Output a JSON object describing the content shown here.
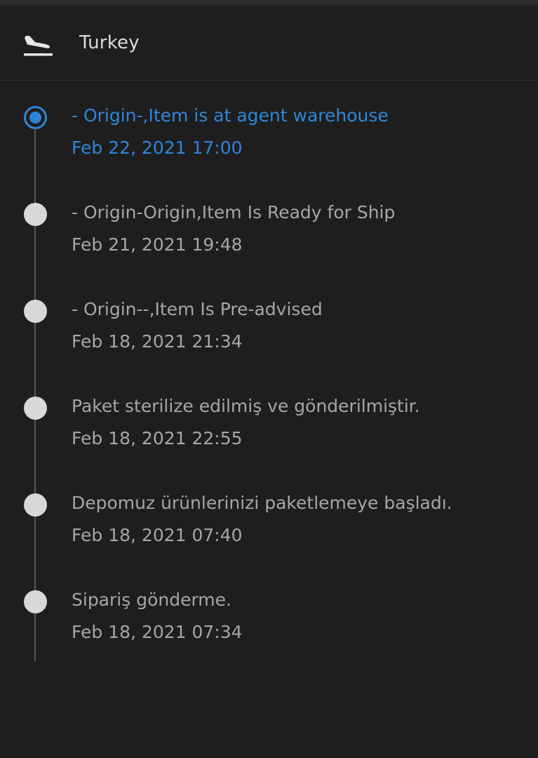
{
  "header": {
    "icon": "flight-landing-icon",
    "title": "Turkey"
  },
  "colors": {
    "background": "#1e1e1e",
    "accent": "#2f86d8",
    "muted_text": "#a6a6a6",
    "dot": "#d8d8d8"
  },
  "events": [
    {
      "description": "- Origin-,Item is at agent warehouse",
      "time": "Feb 22, 2021 17:00",
      "current": true
    },
    {
      "description": "- Origin-Origin,Item Is Ready for Ship",
      "time": "Feb 21, 2021 19:48",
      "current": false
    },
    {
      "description": "- Origin--,Item Is Pre-advised",
      "time": "Feb 18, 2021 21:34",
      "current": false
    },
    {
      "description": "Paket sterilize edilmiş ve gönderilmiştir.",
      "time": "Feb 18, 2021 22:55",
      "current": false
    },
    {
      "description": "Depomuz ürünlerinizi paketlemeye başladı.",
      "time": "Feb 18, 2021 07:40",
      "current": false
    },
    {
      "description": "Sipariş gönderme.",
      "time": "Feb 18, 2021 07:34",
      "current": false
    }
  ]
}
